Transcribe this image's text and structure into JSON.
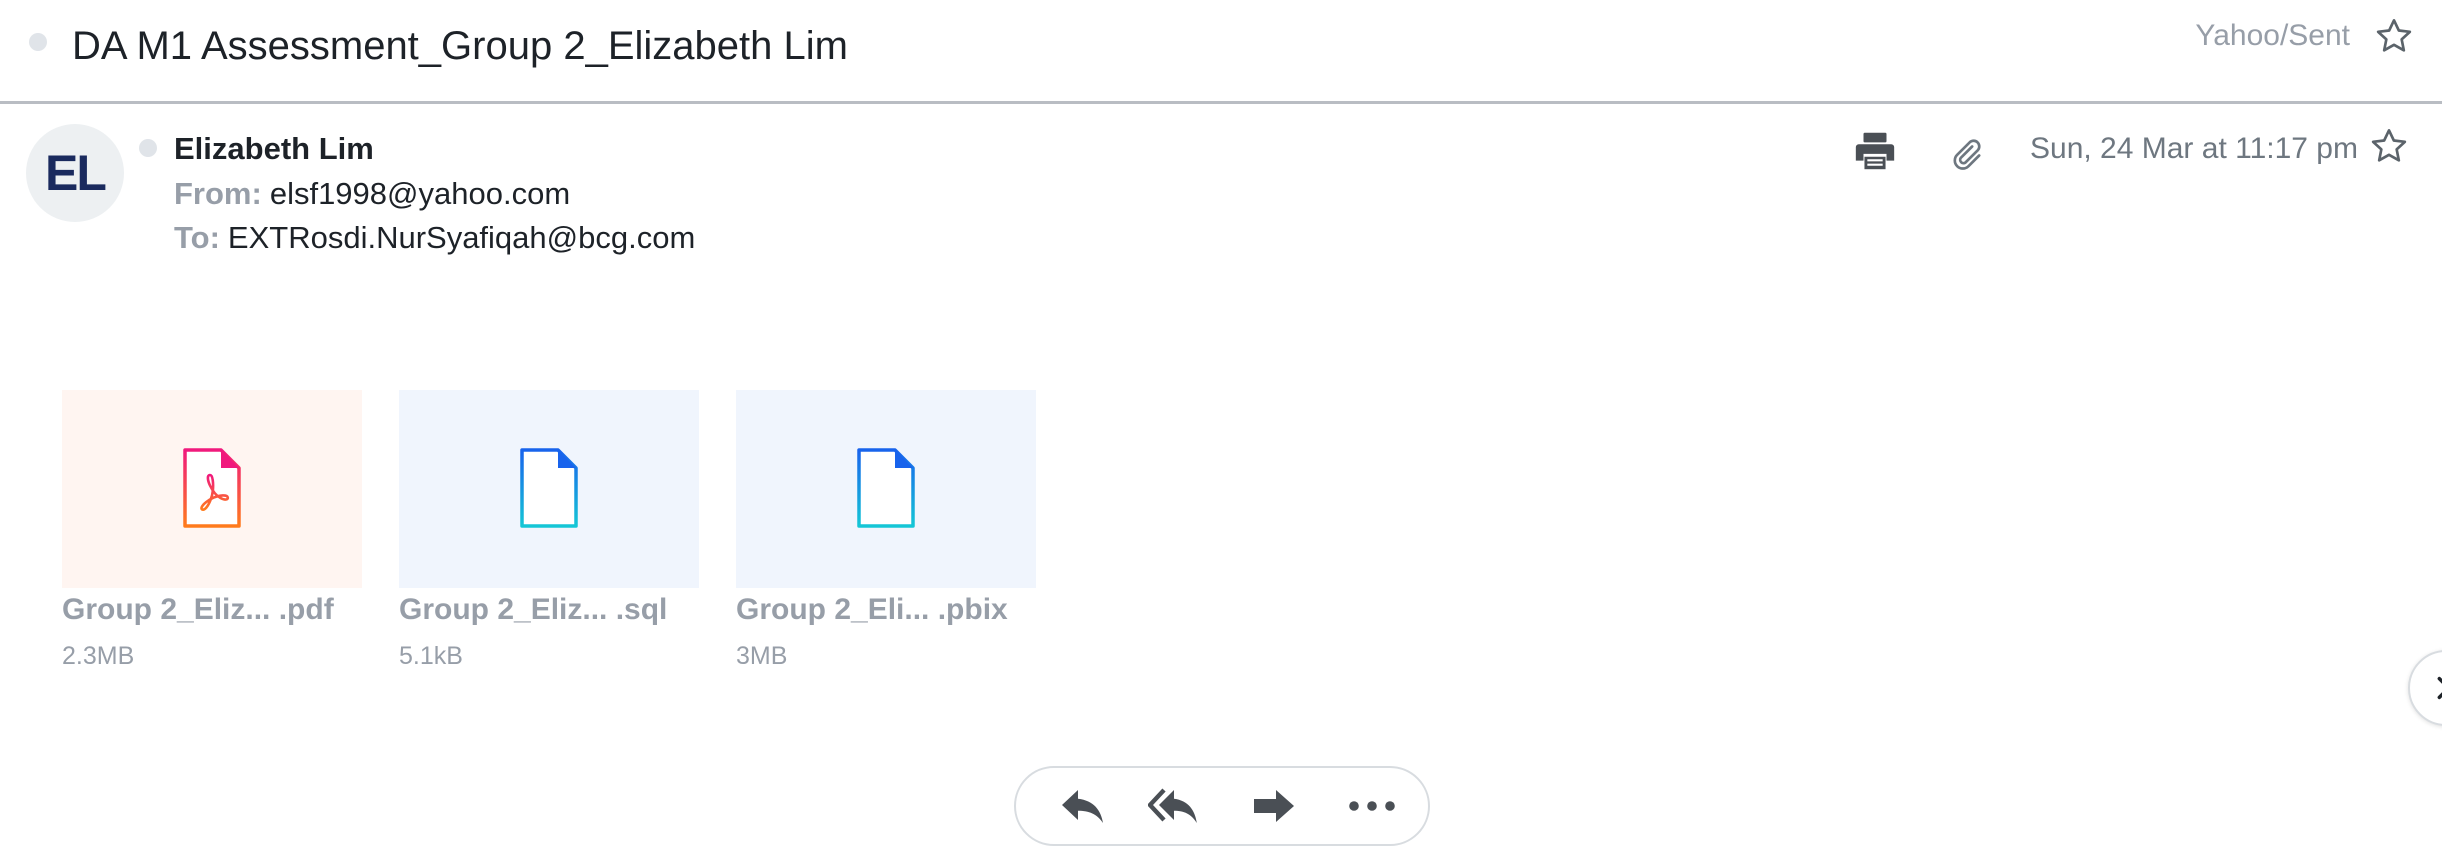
{
  "subject": {
    "title": "DA M1 Assessment_Group 2_Elizabeth Lim",
    "folder": "Yahoo/Sent"
  },
  "message": {
    "avatar_initials": "EL",
    "sender_name": "Elizabeth Lim",
    "from_label": "From:",
    "from_value": "elsf1998@yahoo.com",
    "to_label": "To:",
    "to_value": "EXTRosdi.NurSyafiqah@bcg.com",
    "date": "Sun, 24 Mar at 11:17 pm"
  },
  "icons": {
    "subject_star": "star-outline-icon",
    "print": "printer-icon",
    "attachment": "paperclip-icon",
    "header_star": "star-outline-icon",
    "next": "chevron-right-icon",
    "reply": "reply-icon",
    "reply_all": "reply-all-icon",
    "forward": "forward-icon",
    "more": "more-horizontal-icon"
  },
  "attachments": [
    {
      "name": "Group 2_Eliz... .pdf",
      "size": "2.3MB",
      "type": "pdf-file-icon"
    },
    {
      "name": "Group 2_Eliz... .sql",
      "size": "5.1kB",
      "type": "file-icon"
    },
    {
      "name": "Group 2_Eli... .pbix",
      "size": "3MB",
      "type": "file-icon"
    }
  ],
  "colors": {
    "accent_text": "#1d2228",
    "muted_text": "#979ea8",
    "pdf_thumb_bg": "#fff5f1",
    "file_thumb_bg": "#f0f5fd",
    "avatar_text": "#1a2a5e",
    "icon_dark": "#4a4f55"
  }
}
